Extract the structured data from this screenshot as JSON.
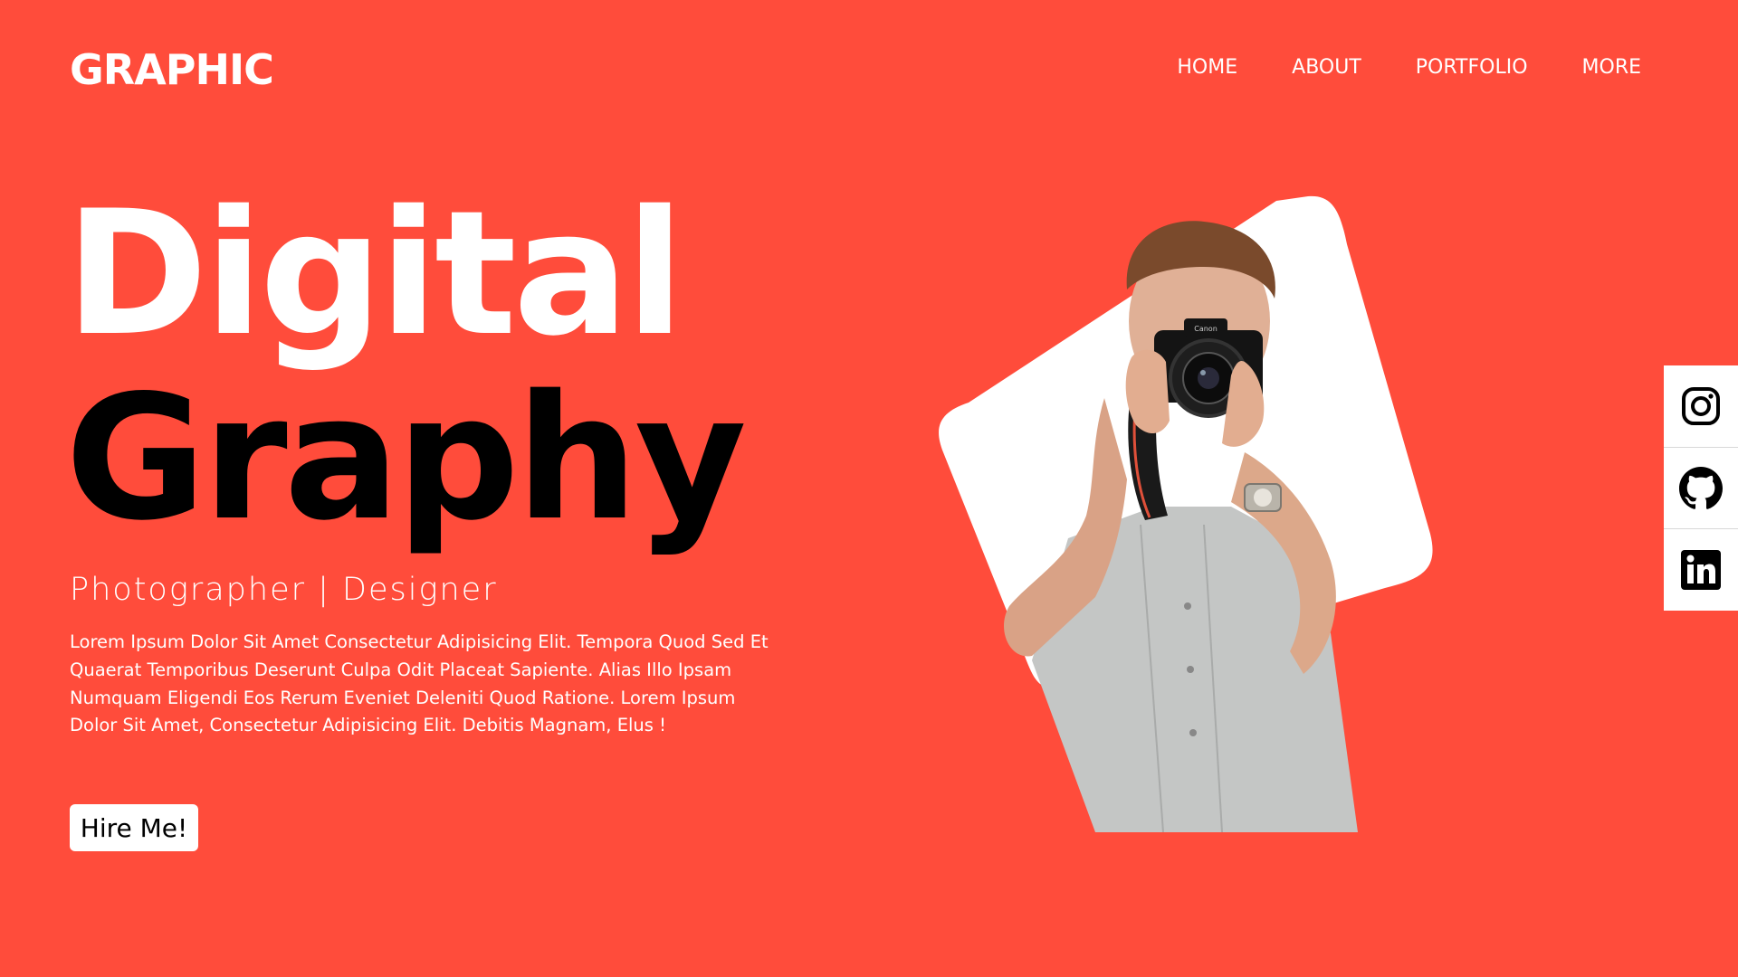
{
  "header": {
    "logo": "GRAPHIC",
    "nav": [
      "HOME",
      "ABOUT",
      "PORTFOLIO",
      "MORE"
    ]
  },
  "hero": {
    "line1": "Digital",
    "line2": "Graphy",
    "subtitle": "Photographer | Designer",
    "description": "Lorem Ipsum Dolor Sit Amet Consectetur Adipisicing Elit. Tempora Quod Sed Et Quaerat Temporibus Deserunt Culpa Odit Placeat Sapiente. Alias Illo Ipsam Numquam Eligendi Eos Rerum Eveniet Deleniti Quod Ratione. Lorem Ipsum Dolor Sit Amet, Consectetur Adipisicing Elit. Debitis Magnam, Elus !",
    "cta": "Hire Me!"
  },
  "image": {
    "camera_brand": "Canon"
  },
  "social": {
    "items": [
      "instagram-icon",
      "github-icon",
      "linkedin-icon"
    ]
  },
  "colors": {
    "background": "#FF4C3B",
    "primary_text": "#FFFFFF",
    "accent_text": "#000000",
    "button_bg": "#FFFFFF"
  }
}
